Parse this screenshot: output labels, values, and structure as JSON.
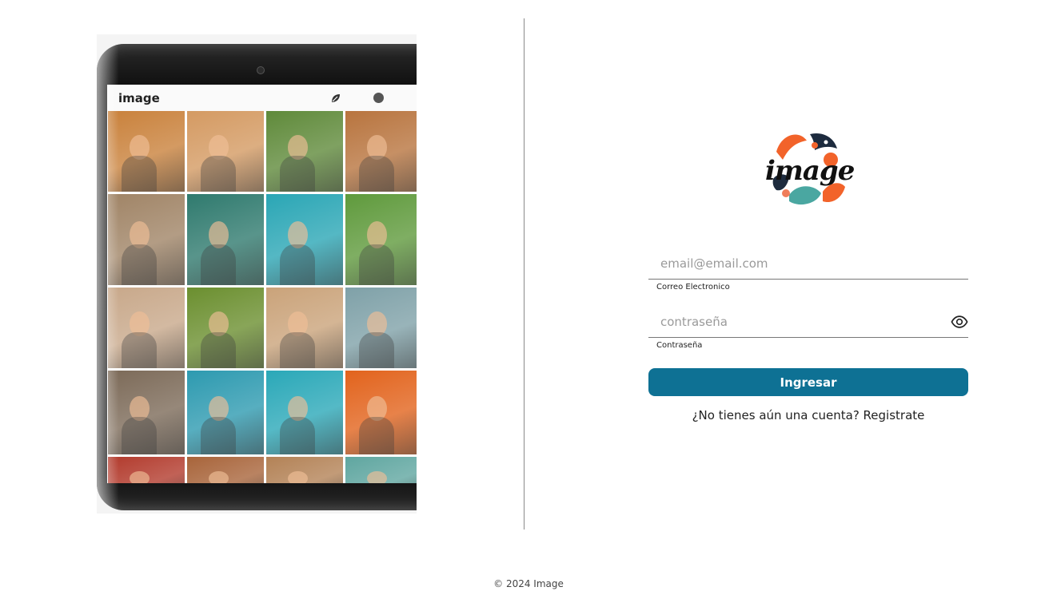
{
  "hero": {
    "app_label": "image",
    "icons": [
      "leaf-icon",
      "profile-dot-icon"
    ],
    "tiles": [
      "#c9813b",
      "#d49a62",
      "#5f8a3a",
      "#b8743e",
      "#a08466",
      "#2f7a6e",
      "#2aa6b5",
      "#5f9a3c",
      "#c8a88a",
      "#6b8f2f",
      "#caa37a",
      "#7fa1a8",
      "#7c6a58",
      "#2d9ab0",
      "#2aa8b8",
      "#e2631c",
      "#b23a2c",
      "#a8643a",
      "#b38256",
      "#5fa6a0"
    ]
  },
  "brand": {
    "logo_text": "image",
    "logo_colors": {
      "orange": "#f2632a",
      "navy": "#1d2b3e",
      "teal": "#4aa7a1",
      "coral": "#ef7d5a"
    }
  },
  "login": {
    "email_placeholder": "email@email.com",
    "email_helper": "Correo Electronico",
    "password_placeholder": "contraseña",
    "password_helper": "Contraseña",
    "show_password_icon": "eye-icon",
    "submit_label": "Ingresar",
    "register_text": "¿No tienes aún una cuenta? Registrate"
  },
  "colors": {
    "accent": "#0e7194"
  },
  "footer": {
    "copyright": "© 2024 Image"
  }
}
